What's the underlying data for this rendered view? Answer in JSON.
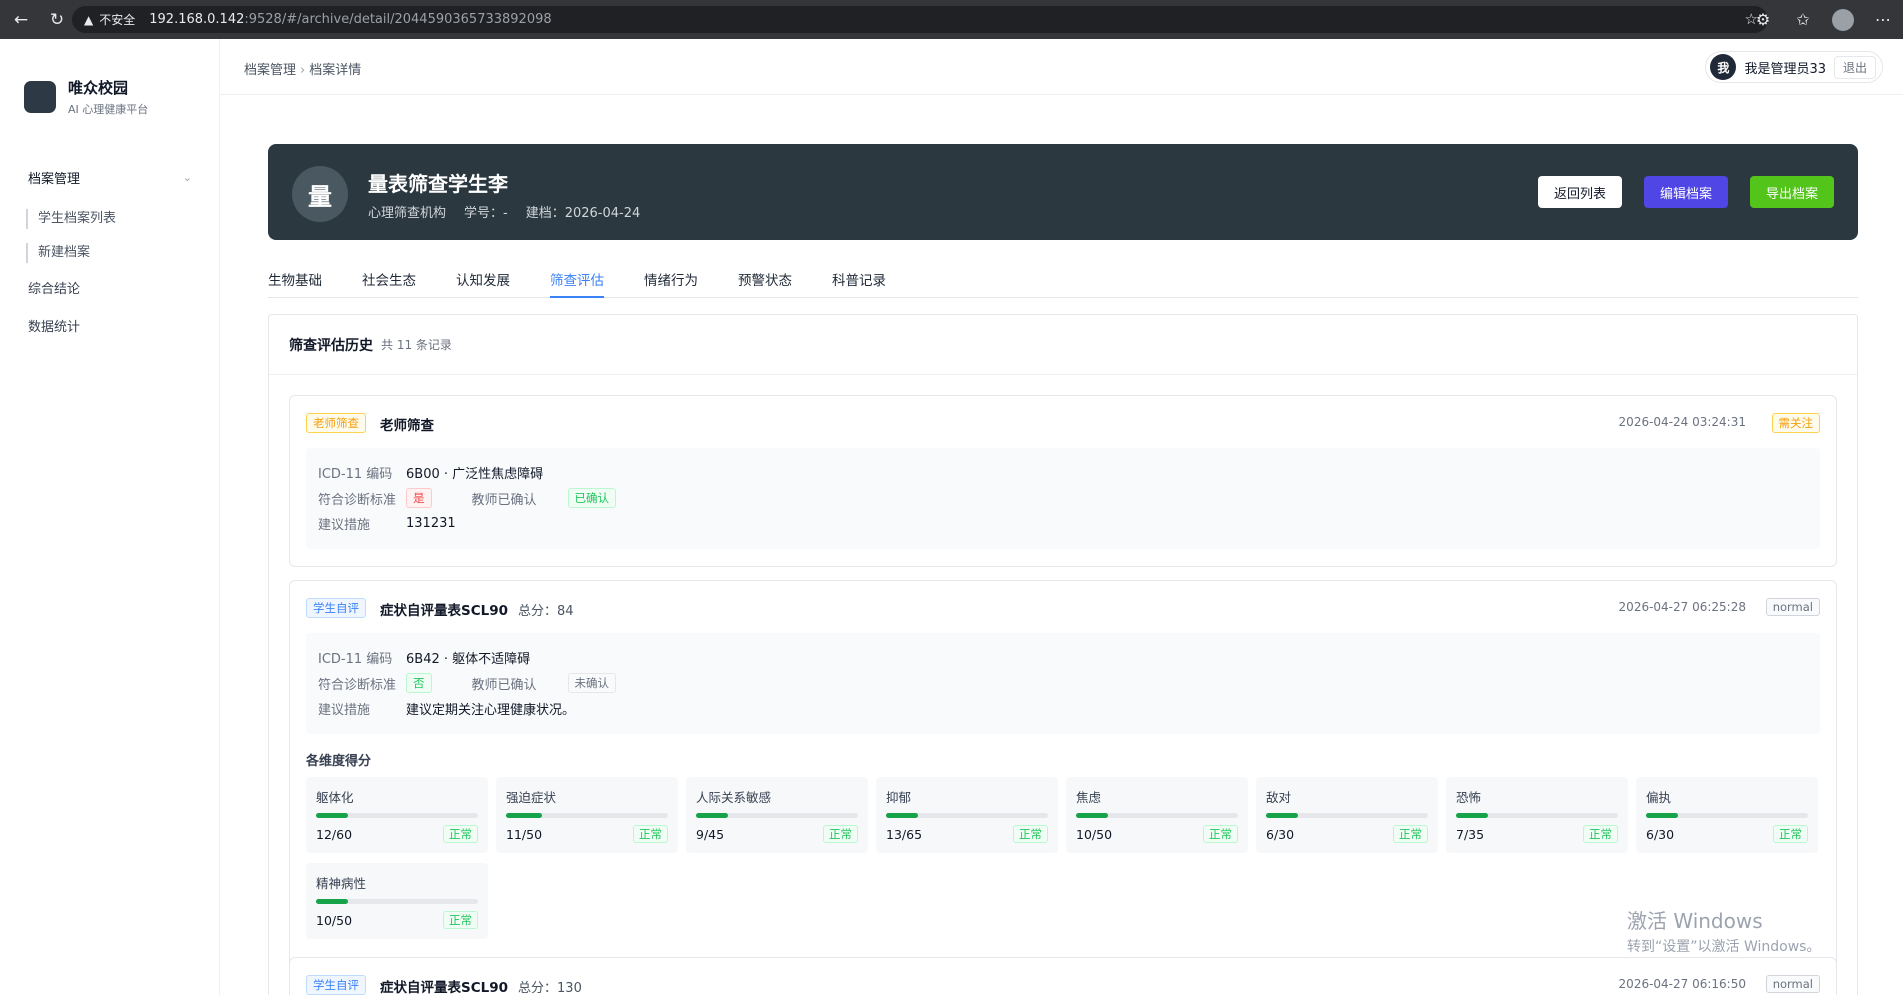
{
  "browser": {
    "insecure_label": "不安全",
    "url_host": "192.168.0.142",
    "url_path": ":9528/#/archive/detail/2044590365733892098"
  },
  "sidebar": {
    "brand_name": "唯众校园",
    "brand_sub": "AI 心理健康平台",
    "group_label": "档案管理",
    "sub_items": [
      {
        "label": "学生档案列表"
      },
      {
        "label": "新建档案"
      }
    ],
    "items": [
      {
        "label": "综合结论"
      },
      {
        "label": "数据统计"
      }
    ]
  },
  "header": {
    "breadcrumb": [
      "档案管理",
      "档案详情"
    ],
    "avatar_char": "我",
    "user_name": "我是管理员33",
    "logout_label": "退出"
  },
  "profile": {
    "avatar_char": "量",
    "name": "量表筛查学生李",
    "org": "心理筛查机构",
    "student_no": "学号：-",
    "created": "建档：2026-04-24",
    "buttons": {
      "back": "返回列表",
      "edit": "编辑档案",
      "export": "导出档案"
    }
  },
  "tabs": [
    {
      "label": "生物基础",
      "active": false
    },
    {
      "label": "社会生态",
      "active": false
    },
    {
      "label": "认知发展",
      "active": false
    },
    {
      "label": "筛查评估",
      "active": true
    },
    {
      "label": "情绪行为",
      "active": false
    },
    {
      "label": "预警状态",
      "active": false
    },
    {
      "label": "科普记录",
      "active": false
    }
  ],
  "history": {
    "title": "筛查评估历史",
    "count": "共 11 条记录",
    "labels": {
      "icd": "ICD-11 编码",
      "criteria": "符合诊断标准",
      "teacher_confirm": "教师已确认",
      "advice": "建议措施",
      "dims_title": "各维度得分"
    },
    "records": [
      {
        "tag": "老师筛查",
        "title": "老师筛查",
        "score": "",
        "time": "2026-04-24 03:24:31",
        "status": "需关注",
        "icd": "6B00 · 广泛性焦虑障碍",
        "criteria": "是",
        "confirm": "已确认",
        "advice": "131231"
      },
      {
        "tag": "学生自评",
        "title": "症状自评量表SCL90",
        "score": "总分：84",
        "time": "2026-04-27 06:25:28",
        "status": "normal",
        "icd": "6B42 · 躯体不适障碍",
        "criteria": "否",
        "confirm": "未确认",
        "advice": "建议定期关注心理健康状况。",
        "dimensions": [
          {
            "name": "躯体化",
            "score": "12/60",
            "ratio": 0.2,
            "status": "正常"
          },
          {
            "name": "强迫症状",
            "score": "11/50",
            "ratio": 0.22,
            "status": "正常"
          },
          {
            "name": "人际关系敏感",
            "score": "9/45",
            "ratio": 0.2,
            "status": "正常"
          },
          {
            "name": "抑郁",
            "score": "13/65",
            "ratio": 0.2,
            "status": "正常"
          },
          {
            "name": "焦虑",
            "score": "10/50",
            "ratio": 0.2,
            "status": "正常"
          },
          {
            "name": "敌对",
            "score": "6/30",
            "ratio": 0.2,
            "status": "正常"
          },
          {
            "name": "恐怖",
            "score": "7/35",
            "ratio": 0.2,
            "status": "正常"
          },
          {
            "name": "偏执",
            "score": "6/30",
            "ratio": 0.2,
            "status": "正常"
          },
          {
            "name": "精神病性",
            "score": "10/50",
            "ratio": 0.2,
            "status": "正常"
          }
        ]
      },
      {
        "tag": "学生自评",
        "title": "症状自评量表SCL90",
        "score": "总分：130",
        "time": "2026-04-27 06:16:50",
        "status": "normal"
      }
    ]
  },
  "watermark": {
    "line1": "激活 Windows",
    "line2": "转到“设置”以激活 Windows。"
  }
}
